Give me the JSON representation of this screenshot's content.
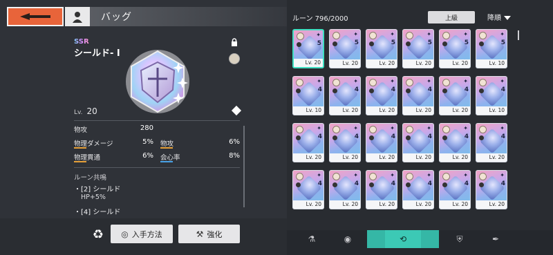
{
  "header": {
    "title": "バッグ"
  },
  "detail": {
    "rarity": "SSR",
    "name": "シールド- I",
    "level_label": "Lv.",
    "level_value": "20",
    "main_stat": {
      "label": "物攻",
      "value": "280"
    },
    "sub_stats": [
      {
        "label": "物理ダメージ",
        "value": "5%"
      },
      {
        "label": "物攻",
        "value": "6%"
      },
      {
        "label": "物理貫通",
        "value": "6%"
      },
      {
        "label": "会心率",
        "value": "8%"
      }
    ],
    "resonance_title": "ルーン共鳴",
    "resonance": [
      {
        "label": "・[2] シールド",
        "effect": "HP+5%"
      },
      {
        "label": "・[4] シールド",
        "effect": ""
      }
    ],
    "buttons": {
      "acquire": "入手方法",
      "enhance": "強化"
    }
  },
  "inventory": {
    "count_text": "ルーン 796/2000",
    "filter_label": "上級",
    "sort_label": "降順",
    "rows": [
      [
        {
          "num": "5",
          "lv": "Lv. 20",
          "sel": true
        },
        {
          "num": "5",
          "lv": "Lv. 20"
        },
        {
          "num": "5",
          "lv": "Lv. 20"
        },
        {
          "num": "5",
          "lv": "Lv. 20"
        },
        {
          "num": "5",
          "lv": "Lv. 20"
        },
        {
          "num": "5",
          "lv": "Lv. 10"
        }
      ],
      [
        {
          "num": "4",
          "lv": "Lv. 10"
        },
        {
          "num": "4",
          "lv": "Lv. 20"
        },
        {
          "num": "4",
          "lv": "Lv. 20"
        },
        {
          "num": "4",
          "lv": "Lv. 20"
        },
        {
          "num": "4",
          "lv": "Lv. 20"
        },
        {
          "num": "4",
          "lv": "Lv. 10"
        }
      ],
      [
        {
          "num": "4",
          "lv": "Lv. 20"
        },
        {
          "num": "4",
          "lv": "Lv. 20"
        },
        {
          "num": "4",
          "lv": "Lv. 20"
        },
        {
          "num": "4",
          "lv": "Lv. 20"
        },
        {
          "num": "4",
          "lv": "Lv. 20"
        },
        {
          "num": "4",
          "lv": "Lv. 20"
        }
      ],
      [
        {
          "num": "4",
          "lv": "Lv. 20"
        },
        {
          "num": "4",
          "lv": "Lv. 20"
        },
        {
          "num": "4",
          "lv": "Lv. 20"
        },
        {
          "num": "4",
          "lv": "Lv. 20"
        },
        {
          "num": "4",
          "lv": "Lv. 20"
        },
        {
          "num": "4",
          "lv": "Lv. 20"
        }
      ]
    ]
  },
  "icons": {
    "back": "arrow-left-icon",
    "avatar": "character-icon",
    "lock": "lock-icon",
    "level": "diamond-icon",
    "recycle": "recycle-icon",
    "tabs": [
      "flask-icon",
      "orb-icon",
      "rune-icon",
      "armor-icon",
      "feather-icon"
    ]
  },
  "colors": {
    "accent": "#e8643a",
    "active_tab": "#3cc9b5",
    "selected_border": "#3ee0c2"
  }
}
